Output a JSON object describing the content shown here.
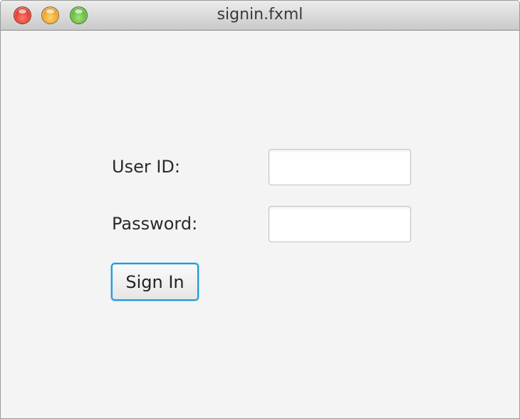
{
  "window": {
    "title": "signin.fxml",
    "controls": [
      "close-icon",
      "minimize-icon",
      "maximize-icon"
    ]
  },
  "form": {
    "user_id_label": "User ID:",
    "user_id_value": "",
    "password_label": "Password:",
    "password_value": "",
    "sign_in_label": "Sign In"
  },
  "colors": {
    "window_bg": "#f4f4f4",
    "focus_accent": "#1f9bd8",
    "close": "#e0392c",
    "minimize": "#e8a12c",
    "maximize": "#5fb83a"
  }
}
